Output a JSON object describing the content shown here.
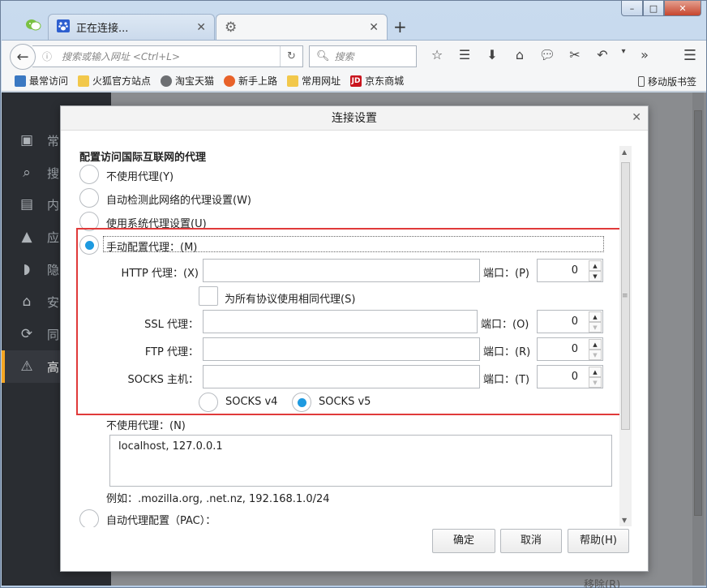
{
  "window": {
    "min_glyph": "–",
    "max_glyph": "□",
    "close_glyph": "✕"
  },
  "tabs": [
    {
      "label": ""
    },
    {
      "label": "正在连接..."
    },
    {
      "label": ""
    }
  ],
  "tab_close": "✕",
  "newtab": "+",
  "nav": {
    "url_placeholder": "搜索或输入网址 <Ctrl+L>",
    "search_placeholder": "搜索"
  },
  "bookmarks": [
    {
      "label": "最常访问",
      "color": "#3a78c2"
    },
    {
      "label": "火狐官方站点",
      "color": "#f2c84b"
    },
    {
      "label": "淘宝天猫",
      "color": "#6d6f72"
    },
    {
      "label": "新手上路",
      "color": "#e8622a"
    },
    {
      "label": "常用网址",
      "color": "#f2c84b"
    },
    {
      "label": "京东商城",
      "color": "#c9151e"
    }
  ],
  "bookmarks_mobile": "移动版书签",
  "sidebar": {
    "items": [
      "常",
      "搜",
      "内",
      "应",
      "隐",
      "安",
      "同",
      "高"
    ]
  },
  "page_behind": {
    "remove_label": "移除(R)"
  },
  "dialog": {
    "title": "连接设置",
    "close": "✕",
    "section_title": "配置访问国际互联网的代理",
    "options": {
      "no_proxy": "不使用代理(Y)",
      "auto_detect": "自动检测此网络的代理设置(W)",
      "system": "使用系统代理设置(U)",
      "manual": "手动配置代理：(M)",
      "auto_pac": "自动代理配置（PAC）："
    },
    "http": {
      "label": "HTTP 代理：(X)",
      "value": "",
      "port_label": "端口：(P)",
      "port": "0"
    },
    "same_proxy": "为所有协议使用相同代理(S)",
    "ssl": {
      "label": "SSL 代理：",
      "value": "",
      "port_label": "端口：(O)",
      "port": "0"
    },
    "ftp": {
      "label": "FTP 代理：",
      "value": "",
      "port_label": "端口：(R)",
      "port": "0"
    },
    "socks": {
      "label": "SOCKS 主机：",
      "value": "",
      "port_label": "端口：(T)",
      "port": "0"
    },
    "socks_v4": "SOCKS v4",
    "socks_v5": "SOCKS v5",
    "no_proxy_for_label": "不使用代理：(N)",
    "no_proxy_for_value": "localhost, 127.0.0.1",
    "example": "例如：.mozilla.org, .net.nz, 192.168.1.0/24",
    "buttons": {
      "ok": "确定",
      "cancel": "取消",
      "help": "帮助(H)"
    }
  },
  "colors": {
    "accent": "#1e9ae0",
    "highlight_box": "#e03a3a",
    "sidebar_bg": "#2a2d32",
    "sidebar_active": "#f5a623"
  }
}
